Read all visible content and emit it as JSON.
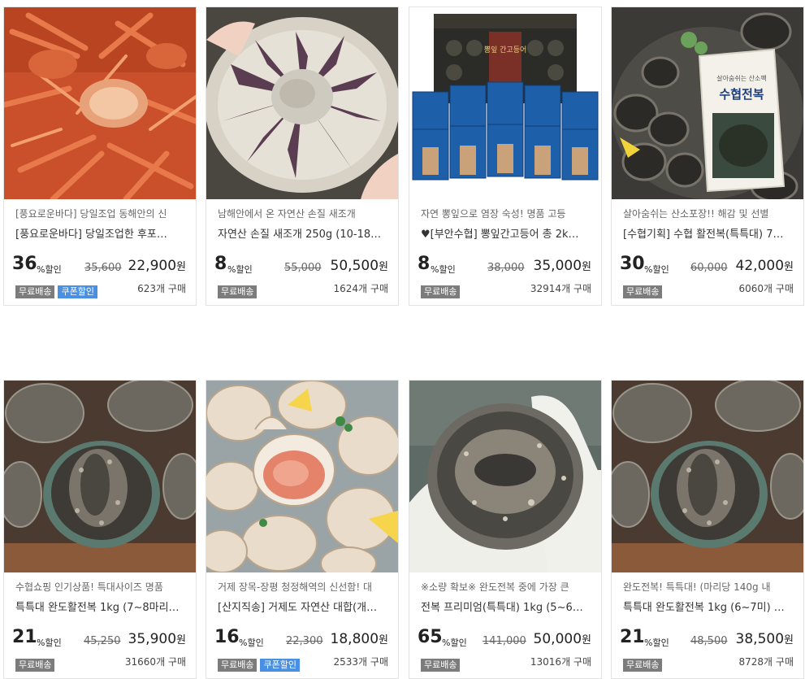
{
  "products": [
    {
      "subtitle": "[풍요로운바다] 당일조업 동해안의 신",
      "name": "[풍요로운바다] 당일조업한 후포…",
      "rate": "36",
      "rate_suffix": "%할인",
      "original_price": "35,600",
      "price": "22,900",
      "won": "원",
      "sold": "623개 구매",
      "badges": [
        "무료배송",
        "쿠폰할인"
      ]
    },
    {
      "subtitle": "남해안에서 온 자연산 손질 새조개",
      "name": "자연산 손질 새조개 250g (10-18…",
      "rate": "8",
      "rate_suffix": "%할인",
      "original_price": "55,000",
      "price": "50,500",
      "won": "원",
      "sold": "1624개 구매",
      "badges": [
        "무료배송"
      ]
    },
    {
      "subtitle": "자연 뽕잎으로 염장 숙성! 명품 고등",
      "name": "♥[부안수협] 뽕잎간고등어 총 2k…",
      "rate": "8",
      "rate_suffix": "%할인",
      "original_price": "38,000",
      "price": "35,000",
      "won": "원",
      "sold": "32914개 구매",
      "badges": [
        "무료배송"
      ]
    },
    {
      "subtitle": "살아숨쉬는 산소포장!! 해감 및 선별",
      "name": "[수협기획] 수협 활전복(특특대) 7…",
      "rate": "30",
      "rate_suffix": "%할인",
      "original_price": "60,000",
      "price": "42,000",
      "won": "원",
      "sold": "6060개 구매",
      "badges": [
        "무료배송"
      ]
    },
    {
      "subtitle": "수협쇼핑 인기상품! 특대사이즈 명품",
      "name": "특특대 완도활전복 1kg (7~8마리…",
      "rate": "21",
      "rate_suffix": "%할인",
      "original_price": "45,250",
      "price": "35,900",
      "won": "원",
      "sold": "31660개 구매",
      "badges": [
        "무료배송"
      ]
    },
    {
      "subtitle": "거제 장목-장평 청정해역의 신선함! 대",
      "name": "[산지직송] 거제도 자연산 대합(개…",
      "rate": "16",
      "rate_suffix": "%할인",
      "original_price": "22,300",
      "price": "18,800",
      "won": "원",
      "sold": "2533개 구매",
      "badges": [
        "무료배송",
        "쿠폰할인"
      ]
    },
    {
      "subtitle": "※소량 확보※ 완도전복 중에 가장 큰",
      "name": "전복 프리미엄(특특대) 1kg (5~6…",
      "rate": "65",
      "rate_suffix": "%할인",
      "original_price": "141,000",
      "price": "50,000",
      "won": "원",
      "sold": "13016개 구매",
      "badges": [
        "무료배송"
      ]
    },
    {
      "subtitle": "완도전복! 특특대! (마리당 140g 내",
      "name": "특특대 완도활전복 1kg (6~7미) …",
      "rate": "21",
      "rate_suffix": "%할인",
      "original_price": "48,500",
      "price": "38,500",
      "won": "원",
      "sold": "8728개 구매",
      "badges": [
        "무료배송"
      ]
    }
  ],
  "image_labels": {
    "mackerel_box_label": "뽕잎 간고등어",
    "abalone_pack_label": "수협전복",
    "abalone_pack_small": "살아숨쉬는 산소팩"
  }
}
